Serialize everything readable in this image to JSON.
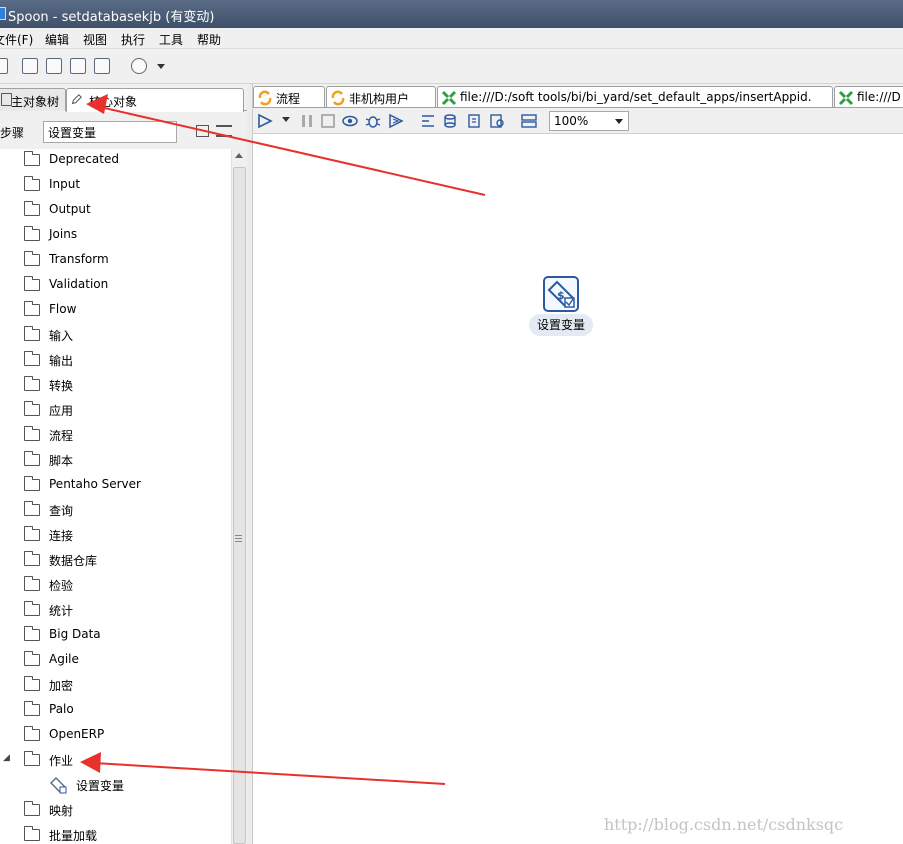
{
  "window": {
    "title": "Spoon - setdatabasekjb (有变动)"
  },
  "menu": {
    "items": [
      "文件(F)",
      "编辑",
      "视图",
      "执行",
      "工具",
      "帮助"
    ]
  },
  "left_tabs": [
    {
      "label": "主对象树",
      "icon": "tree-icon"
    },
    {
      "label": "核心对象",
      "icon": "pencil-icon"
    }
  ],
  "steps": {
    "label": "步骤",
    "search_value": "设置变量"
  },
  "tree": {
    "folders": [
      "Deprecated",
      "Input",
      "Output",
      "Joins",
      "Transform",
      "Validation",
      "Flow",
      "输入",
      "输出",
      "转换",
      "应用",
      "流程",
      "脚本",
      "Pentaho Server",
      "查询",
      "连接",
      "数据仓库",
      "检验",
      "统计",
      "Big Data",
      "Agile",
      "加密",
      "Palo",
      "OpenERP",
      "作业"
    ],
    "expanded_child": "设置变量",
    "folders_after": [
      "映射",
      "批量加载"
    ]
  },
  "right_tabs": [
    {
      "label": "流程",
      "icon": "transformation-icon"
    },
    {
      "label": "非机构用户",
      "icon": "transformation-icon"
    },
    {
      "label": "file:///D:/soft tools/bi/bi_yard/set_default_apps/insertAppid.",
      "icon": "job-icon"
    },
    {
      "label": "file:///D",
      "icon": "job-icon"
    }
  ],
  "zoom": {
    "value": "100%"
  },
  "canvas": {
    "node_label": "设置变量"
  },
  "watermark": "http://blog.csdn.net/csdnksqc",
  "colors": {
    "titlebar": "#4a5a73",
    "arrow": "#e8302c",
    "node_border": "#2b5aa0"
  }
}
